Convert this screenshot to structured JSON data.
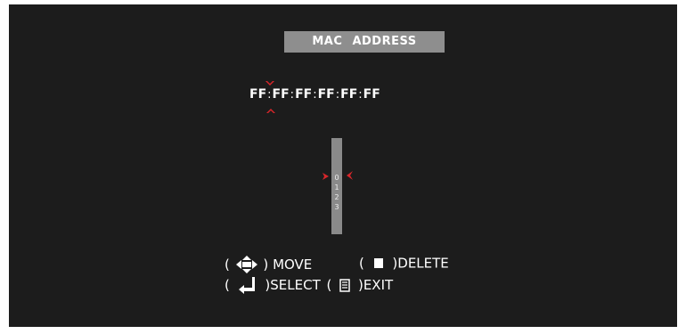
{
  "title": {
    "label": "MAC  ADDRESS"
  },
  "mac": {
    "octets": [
      "FF",
      "FF",
      "FF",
      "FF",
      "FF",
      "FF"
    ],
    "separator": ":"
  },
  "digit_list": {
    "items": [
      "0",
      "1",
      "2",
      "3"
    ],
    "selected": "0"
  },
  "help": {
    "move": {
      "paren_open": "(",
      "paren_close": ")",
      "label": "MOVE",
      "icon": "dpad-arrows-icon"
    },
    "delete": {
      "paren_open": "(",
      "paren_close": ")",
      "label": "DELETE",
      "icon": "stop-square-icon"
    },
    "select": {
      "paren_open": "(",
      "paren_close": ")",
      "label": "SELECT",
      "icon": "enter-return-icon"
    },
    "exit": {
      "paren_open": "(",
      "paren_close": ")",
      "label": "EXIT",
      "icon": "menu-list-icon"
    }
  },
  "colors": {
    "background": "#1c1c1c",
    "title_bg": "#8e8e8e",
    "cursor": "#d8262a",
    "text": "#ffffff",
    "scroll_bg": "#8a8a8a"
  }
}
